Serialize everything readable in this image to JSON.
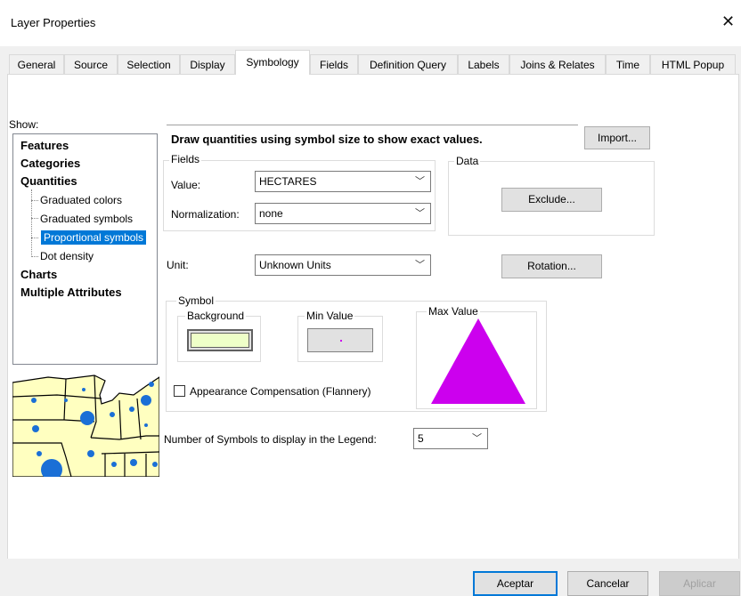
{
  "window": {
    "title": "Layer Properties",
    "close_glyph": "✕"
  },
  "tabs": [
    {
      "label": "General"
    },
    {
      "label": "Source"
    },
    {
      "label": "Selection"
    },
    {
      "label": "Display"
    },
    {
      "label": "Symbology",
      "active": true
    },
    {
      "label": "Fields"
    },
    {
      "label": "Definition Query"
    },
    {
      "label": "Labels"
    },
    {
      "label": "Joins & Relates"
    },
    {
      "label": "Time"
    },
    {
      "label": "HTML Popup"
    }
  ],
  "show": {
    "label": "Show:",
    "features": "Features",
    "categories": "Categories",
    "quantities": "Quantities",
    "sub": [
      "Graduated colors",
      "Graduated symbols",
      "Proportional symbols",
      "Dot density"
    ],
    "charts": "Charts",
    "multiple": "Multiple Attributes"
  },
  "description": "Draw quantities using symbol size to show exact values.",
  "import_label": "Import...",
  "fields": {
    "group": "Fields",
    "value_label": "Value:",
    "value": "HECTARES",
    "norm_label": "Normalization:",
    "norm": "none"
  },
  "data": {
    "group": "Data",
    "exclude_label": "Exclude..."
  },
  "unit": {
    "label": "Unit:",
    "value": "Unknown Units"
  },
  "rotation_label": "Rotation...",
  "symbol": {
    "group": "Symbol",
    "background": "Background",
    "min_value": "Min Value",
    "max_value": "Max Value",
    "appearance": "Appearance Compensation (Flannery)",
    "background_color": "#eeffc8",
    "max_color": "#cc00ee"
  },
  "legend": {
    "label": "Number of Symbols to display in the Legend:",
    "value": "5"
  },
  "buttons": {
    "ok": "Aceptar",
    "cancel": "Cancelar",
    "apply": "Aplicar"
  },
  "colors": {
    "accent": "#0078d7",
    "preview_fill": "#ffffc0",
    "preview_dot": "#1a6fd6"
  }
}
